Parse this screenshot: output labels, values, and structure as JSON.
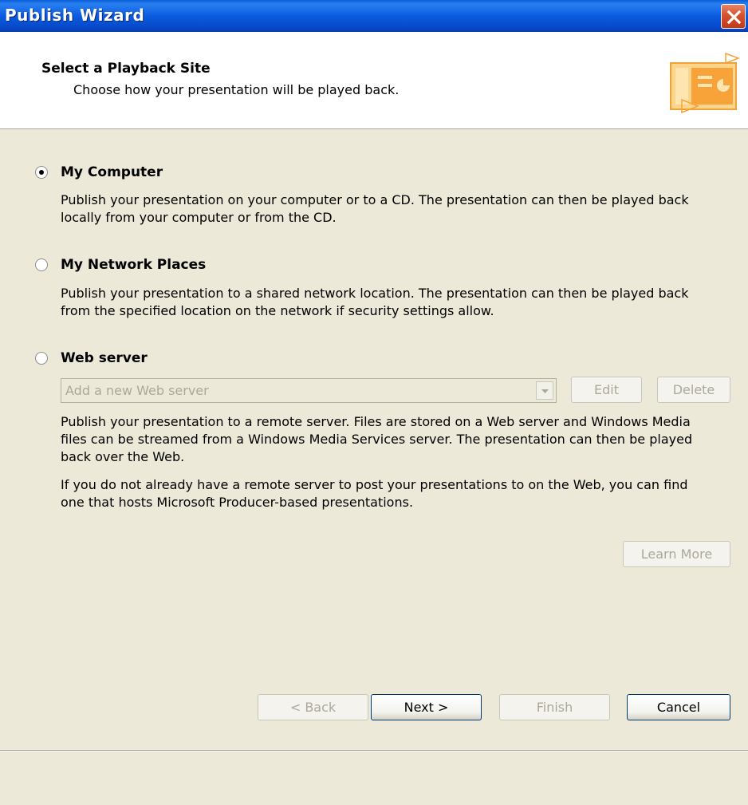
{
  "window": {
    "title": "Publish Wizard"
  },
  "header": {
    "title": "Select a Playback Site",
    "subtitle": "Choose how your presentation will be played back."
  },
  "options": {
    "my_computer": {
      "label": "My Computer",
      "selected": true,
      "description": "Publish your presentation on your computer or to a CD. The presentation can then be played back locally from your computer or from the CD."
    },
    "network_places": {
      "label": "My Network Places",
      "selected": false,
      "description": "Publish your presentation to a shared network location. The presentation can then be played back from the specified location on the network if security settings allow."
    },
    "web_server": {
      "label": "Web server",
      "selected": false,
      "server_select_value": "Add a new Web server",
      "edit_label": "Edit",
      "delete_label": "Delete",
      "description": "Publish your presentation to a remote server. Files are stored on a Web server and Windows Media files can be streamed from a Windows Media Services server. The presentation can then be played back over the Web.",
      "hosting_note": "If you do not already have a remote server to post your presentations to on the Web, you can find one that hosts Microsoft Producer-based presentations.",
      "learn_more_label": "Learn More"
    }
  },
  "footer": {
    "back_label": "< Back",
    "next_label": "Next >",
    "finish_label": "Finish",
    "cancel_label": "Cancel"
  },
  "icons": {
    "close": "close-icon",
    "header_graphic": "presentation-icon",
    "dropdown": "chevron-down-icon"
  },
  "colors": {
    "titlebar": "#0A5FD8",
    "close_button": "#D5522E",
    "dialog_background": "#ECE9D8",
    "header_background": "#FFFFFF",
    "disabled_text": "#ACA899",
    "accent_orange": "#F7A33A"
  }
}
